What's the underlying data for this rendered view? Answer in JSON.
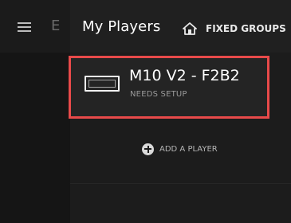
{
  "header": {
    "title": "My Players",
    "groups_tab_label": "FIXED GROUPS",
    "rail_letter": "E"
  },
  "player": {
    "name": "M10 V2 - F2B2",
    "status": "NEEDS SETUP"
  },
  "add_player": {
    "label": "ADD A PLAYER"
  },
  "colors": {
    "highlight_border": "#e84a4a",
    "background": "#1c1c1c"
  },
  "icons": [
    "hamburger-menu-icon",
    "home-icon",
    "display-device-icon",
    "plus-circle-icon"
  ]
}
